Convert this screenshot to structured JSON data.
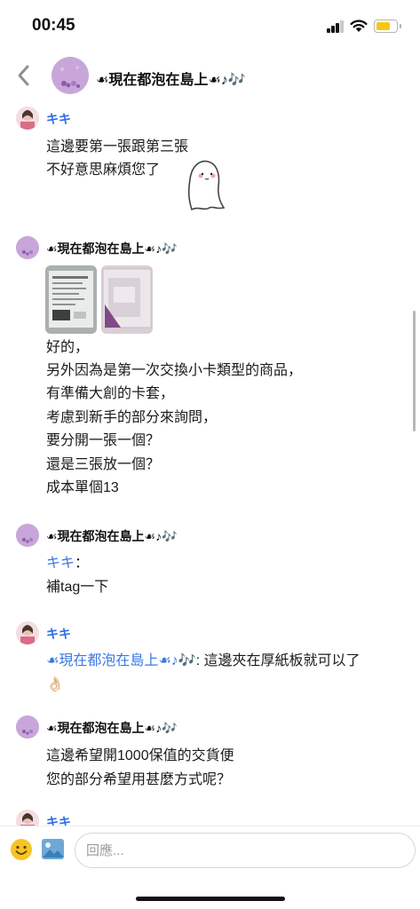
{
  "status_bar": {
    "time": "00:45",
    "battery_color": "#f6c915"
  },
  "header": {
    "back_icon": "chevron-left-icon",
    "title": "☙現在都泡在島上☙♪🎶"
  },
  "messages": [
    {
      "sender": "キキ",
      "lines": [
        "這邊要第一張跟第三張",
        "不好意思麻煩您了"
      ],
      "sticker": "ghost-sticker"
    },
    {
      "sender": "☙現在都泡在島上☙♪🎶",
      "attachments": [
        "product-photo-1",
        "product-photo-2"
      ],
      "lines": [
        "好的，",
        "另外因為是第一次交換小卡類型的商品，",
        "有準備大創的卡套，",
        "考慮到新手的部分來詢問，",
        "要分開一張一個？",
        "還是三張放一個？",
        "成本單個13"
      ]
    },
    {
      "sender": "☙現在都泡在島上☙♪🎶",
      "mention": "キキ",
      "mention_suffix": "：",
      "lines": [
        "補tag一下"
      ]
    },
    {
      "sender": "キキ",
      "mention": "☙現在都泡在島上☙♪🎶",
      "mention_suffix": ": 這邊夾在厚紙板就可以了",
      "emoji": "👌🏻"
    },
    {
      "sender": "☙現在都泡在島上☙♪🎶",
      "lines": [
        "這邊希望開1000保值的交貨便",
        "您的部分希望用甚麼方式呢？"
      ]
    },
    {
      "sender": "キキ"
    }
  ],
  "composer": {
    "placeholder": "回應...",
    "value": "",
    "emoji_icon": "smiley-icon",
    "image_icon": "image-icon"
  },
  "colors": {
    "mention": "#3a78e4",
    "sender_blue": "#2f6ee3",
    "group_avatar": "#c9a8dc"
  }
}
